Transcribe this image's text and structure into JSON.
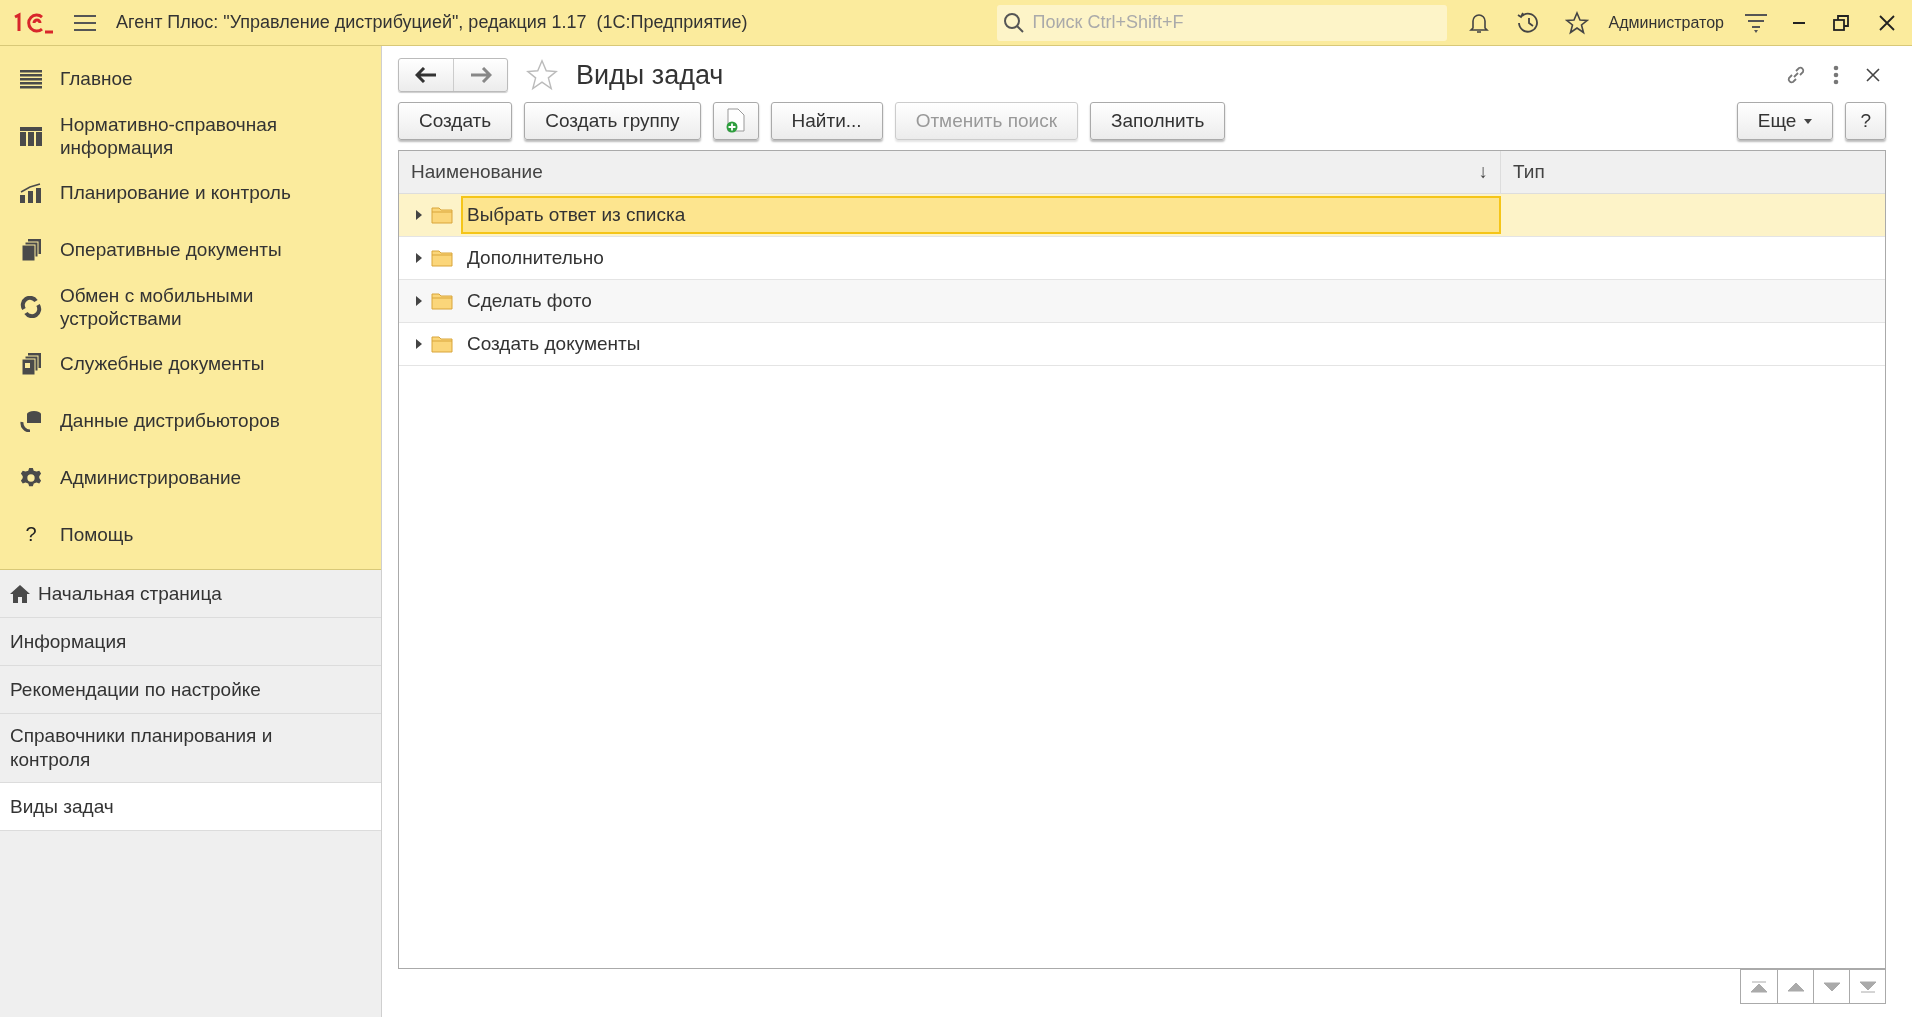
{
  "header": {
    "title": "Агент Плюс: \"Управление дистрибуцией\", редакция 1.17  (1С:Предприятие)",
    "search": {
      "placeholder": "Поиск Ctrl+Shift+F"
    },
    "user": "Администратор"
  },
  "sections": [
    {
      "label": "Главное",
      "kind": "lines"
    },
    {
      "label": "Нормативно-справочная информация",
      "kind": "columns"
    },
    {
      "label": "Планирование и контроль",
      "kind": "chart"
    },
    {
      "label": "Оперативные документы",
      "kind": "docs"
    },
    {
      "label": "Обмен с мобильными устройствами",
      "kind": "sync"
    },
    {
      "label": "Служебные документы",
      "kind": "servicedocs"
    },
    {
      "label": "Данные дистрибьюторов",
      "kind": "data"
    },
    {
      "label": "Администрирование",
      "kind": "gear"
    },
    {
      "label": "Помощь",
      "kind": "help",
      "glyph": "?"
    }
  ],
  "open_pages": [
    {
      "label": "Начальная страница",
      "kind": "home",
      "selected": false
    },
    {
      "label": "Информация",
      "kind": "plain",
      "selected": false
    },
    {
      "label": "Рекомендации по настройке",
      "kind": "plain",
      "selected": false
    },
    {
      "label": "Справочники планирования и контроля",
      "kind": "plain",
      "selected": false
    },
    {
      "label": "Виды задач",
      "kind": "plain",
      "selected": true
    }
  ],
  "form": {
    "title": "Виды задач",
    "favorite": false,
    "toolbar": [
      {
        "kind": "text",
        "label": "Создать",
        "disabled": false
      },
      {
        "kind": "text",
        "label": "Создать группу",
        "disabled": false
      },
      {
        "kind": "add-document",
        "disabled": false
      },
      {
        "kind": "text",
        "label": "Найти...",
        "disabled": false
      },
      {
        "kind": "text",
        "label": "Отменить поиск",
        "disabled": true
      },
      {
        "kind": "text",
        "label": "Заполнить",
        "disabled": false
      }
    ],
    "more": "Еще",
    "help": "?",
    "table": {
      "columns": [
        "Наименование",
        "Тип"
      ],
      "sort_mark": "↓",
      "rows": [
        {
          "name": "Выбрать ответ из списка",
          "selected": true,
          "expanded": false
        },
        {
          "name": "Дополнительно",
          "selected": false,
          "expanded": false
        },
        {
          "name": "Сделать фото",
          "selected": false,
          "expanded": false
        },
        {
          "name": "Создать документы",
          "selected": false,
          "expanded": false
        }
      ]
    }
  }
}
